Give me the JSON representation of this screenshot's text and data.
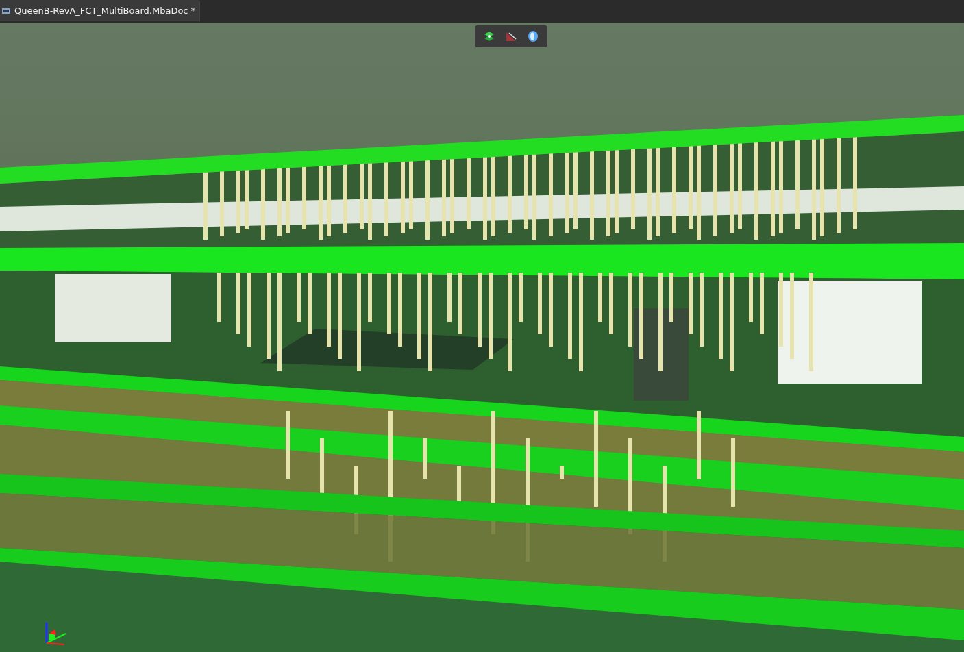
{
  "document_tab": {
    "title": "QueenB-RevA_FCT_MultiBoard.MbaDoc *",
    "selected": true
  }
}
